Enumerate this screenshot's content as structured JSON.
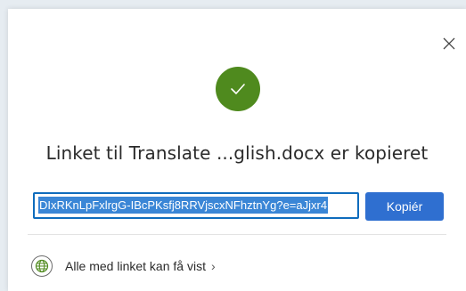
{
  "dialog": {
    "title": "Linket til Translate ...glish.docx er kopieret",
    "link_value": "DIxRKnLpFxlrgG-IBcPKsfj8RRVjscxNFhztnYg?e=aJjxr4",
    "copy_button_label": "Kopiér",
    "permission_label": "Alle med linket kan få vist",
    "permission_chevron": "›"
  },
  "colors": {
    "success_green": "#4f8a1e",
    "accent_blue": "#2f6fd0",
    "selection_blue": "#3a86d6"
  },
  "icons": {
    "close": "close-icon",
    "success": "checkmark-icon",
    "globe": "globe-icon"
  }
}
